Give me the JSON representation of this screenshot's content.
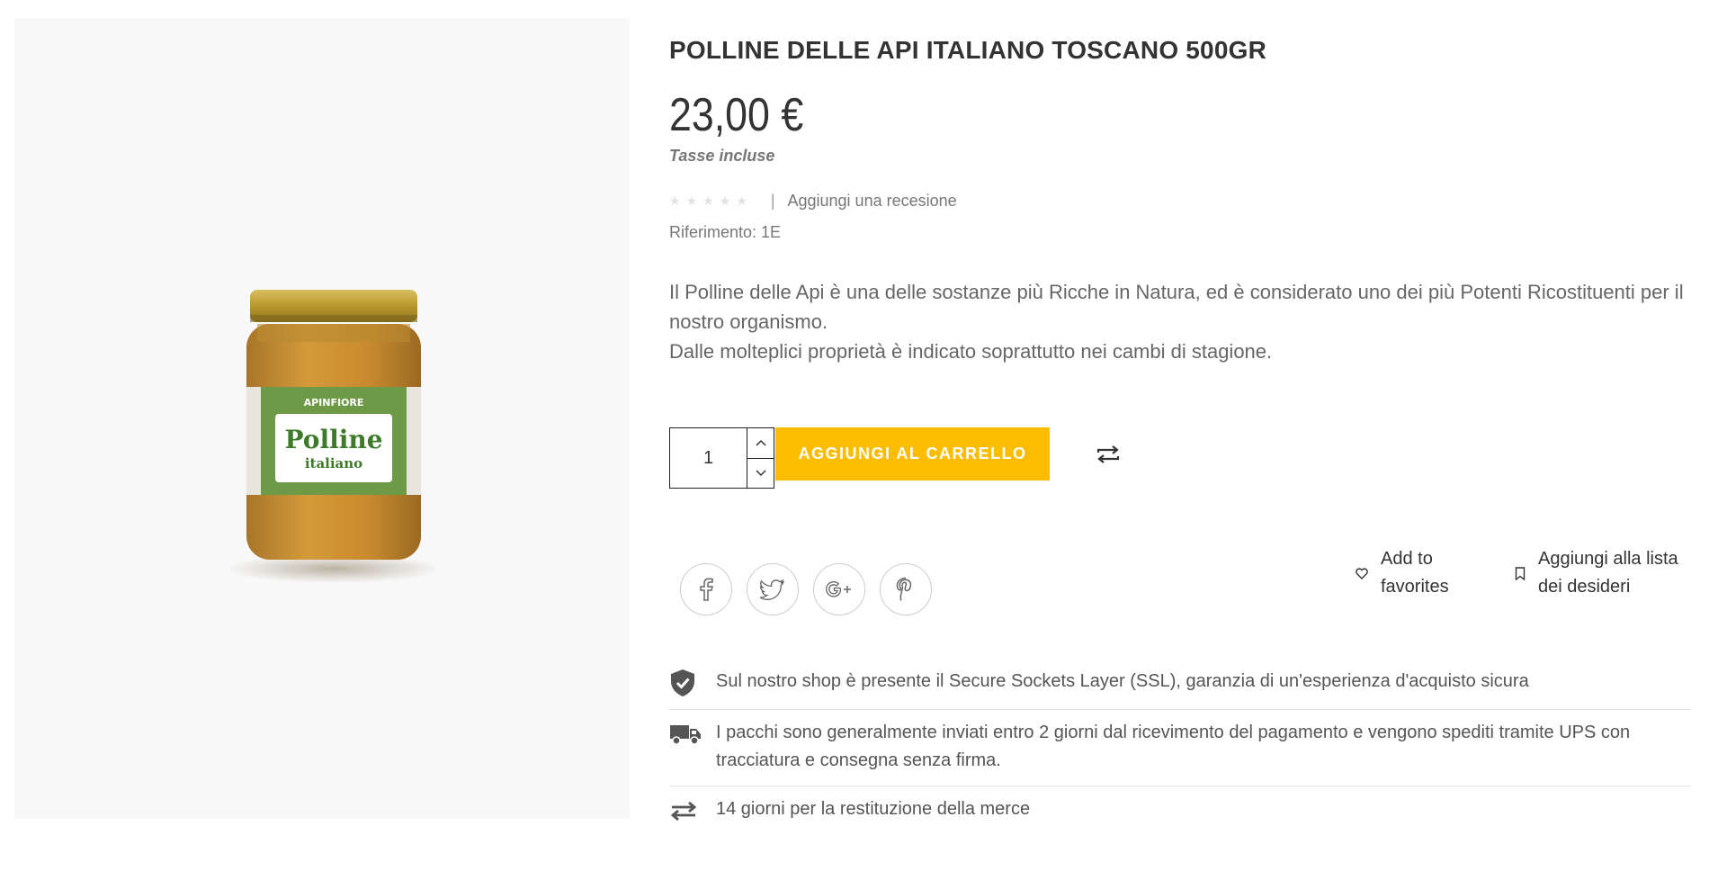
{
  "product": {
    "title": "POLLINE DELLE API ITALIANO TOSCANO 500GR",
    "price": "23,00 €",
    "tax_note": "Tasse incluse",
    "rating_stars": 0,
    "review_link": "Aggiungi una recesione",
    "reference": "Riferimento: 1E",
    "description": [
      "Il Polline delle Api è una delle sostanze più Ricche in Natura, ed è considerato uno dei più Potenti Ricostituenti per il nostro organismo.",
      "Dalle molteplici proprietà è indicato soprattutto nei cambi di stagione."
    ],
    "image": {
      "brand": "APINFIORE",
      "name": "Polline",
      "subname": "italiano"
    }
  },
  "cart": {
    "quantity": "1",
    "add_label": "AGGIUNGI AL CARRELLO"
  },
  "actions": {
    "favorites_line1": "Add to",
    "favorites_line2": "favorites",
    "wishlist_line1": "Aggiungi alla lista",
    "wishlist_line2": "dei desideri"
  },
  "social": [
    "facebook-icon",
    "twitter-icon",
    "google-plus-icon",
    "pinterest-icon"
  ],
  "reassurance": [
    {
      "icon": "shield-check-icon",
      "text": "Sul nostro shop è presente il Secure Sockets Layer (SSL), garanzia di un'esperienza d'acquisto sicura"
    },
    {
      "icon": "truck-icon",
      "text": "I pacchi sono generalmente inviati entro 2 giorni dal ricevimento del pagamento e vengono spediti tramite UPS con tracciatura e consegna senza firma."
    },
    {
      "icon": "exchange-arrows-icon",
      "text": "14 giorni per la restituzione della merce"
    }
  ],
  "colors": {
    "accent": "#fcbd00",
    "text_dark": "#333333",
    "text_muted": "#777777",
    "image_bg": "#f8f8f8"
  }
}
